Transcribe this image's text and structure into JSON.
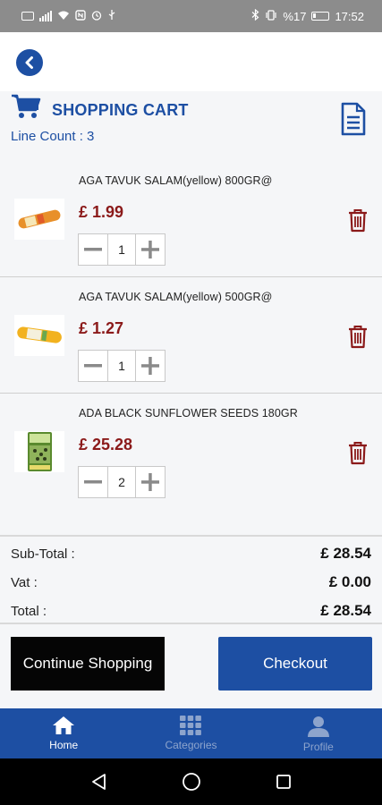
{
  "status_bar": {
    "left_icons": [
      "sim-icon",
      "signal-icon",
      "wifi-icon",
      "nfc-icon",
      "alarm-icon",
      "usb-icon"
    ],
    "right_icons": [
      "bluetooth-icon",
      "vibrate-icon"
    ],
    "battery_text": "%17",
    "time": "17:52"
  },
  "header": {
    "back_icon": "chevron-left-icon"
  },
  "cart": {
    "title": "SHOPPING CART",
    "line_count": "Line Count : 3",
    "accent_color": "#1d4fa3"
  },
  "items": [
    {
      "name": "AGA TAVUK SALAM(yellow) 800GR@",
      "price": "£ 1.99",
      "quantity": "1",
      "image": "salami-orange-product"
    },
    {
      "name": "AGA TAVUK SALAM(yellow) 500GR@",
      "price": "£ 1.27",
      "quantity": "1",
      "image": "salami-yellow-product"
    },
    {
      "name": "ADA BLACK SUNFLOWER SEEDS 180GR",
      "price": "£ 25.28",
      "quantity": "2",
      "image": "sunflower-seeds-bag-product"
    }
  ],
  "totals": {
    "subtotal_label": "Sub-Total :",
    "subtotal_value": "£ 28.54",
    "vat_label": "Vat :",
    "vat_value": "£ 0.00",
    "total_label": "Total :",
    "total_value": "£ 28.54"
  },
  "actions": {
    "continue_label": "Continue Shopping",
    "checkout_label": "Checkout"
  },
  "tabs": [
    {
      "label": "Home",
      "icon": "home-icon",
      "active": true
    },
    {
      "label": "Categories",
      "icon": "grid-icon",
      "active": false
    },
    {
      "label": "Profile",
      "icon": "user-icon",
      "active": false
    }
  ],
  "colors": {
    "price": "#8b1a1a",
    "brand_blue": "#1d4fa3",
    "trash": "#8b1a1a"
  }
}
